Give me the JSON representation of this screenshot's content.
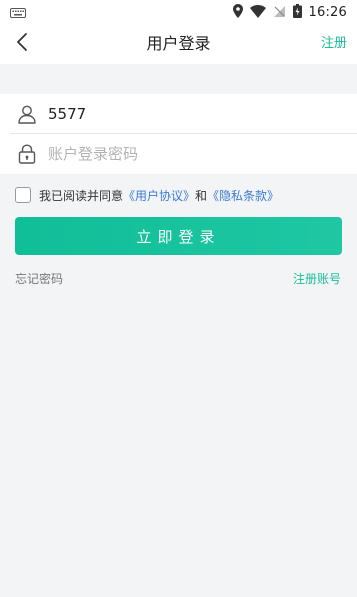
{
  "status_bar": {
    "time": "16:26",
    "icons": [
      "keyboard-icon",
      "location-icon",
      "wifi-icon",
      "no-sim-icon",
      "battery-icon"
    ]
  },
  "nav": {
    "title": "用户登录",
    "register_label": "注册",
    "back_icon": "chevron-left-icon"
  },
  "form": {
    "username": {
      "value": "5577",
      "icon": "user-icon"
    },
    "password": {
      "placeholder": "账户登录密码",
      "icon": "lock-icon"
    }
  },
  "agreement": {
    "checked": false,
    "prefix": "我已阅读并同意",
    "user_agreement": "《用户协议》",
    "conjunction": "和",
    "privacy": "《隐私条款》"
  },
  "login_button": "立即登录",
  "forgot_password": "忘记密码",
  "register_account": "注册账号",
  "colors": {
    "accent": "#1bbd98",
    "link": "#3a7bd5",
    "background": "#f3f4f6"
  }
}
